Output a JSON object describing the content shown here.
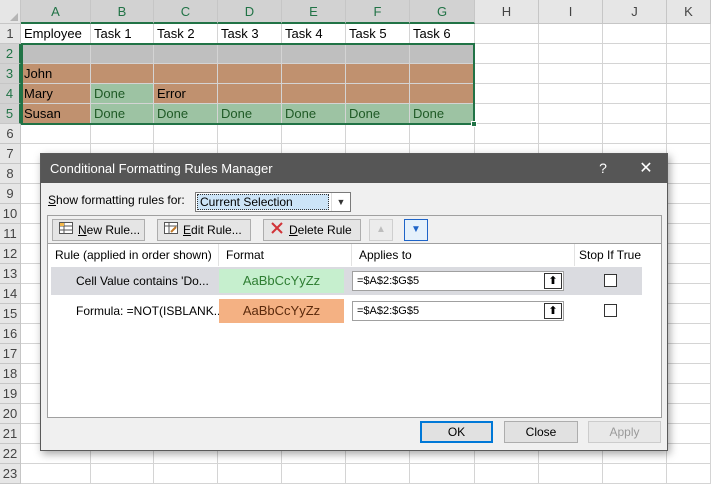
{
  "spreadsheet": {
    "columns": [
      "A",
      "B",
      "C",
      "D",
      "E",
      "F",
      "G",
      "H",
      "I",
      "J",
      "K"
    ],
    "rows": [
      "1",
      "2",
      "3",
      "4",
      "5",
      "6",
      "7",
      "8",
      "9",
      "10",
      "11",
      "12",
      "13",
      "14",
      "15",
      "16",
      "17",
      "18",
      "19",
      "20",
      "21",
      "22",
      "23"
    ],
    "header_row": [
      "Employee",
      "Task 1",
      "Task 2",
      "Task 3",
      "Task 4",
      "Task 5",
      "Task 6"
    ],
    "data_rows": [
      [
        "John",
        "",
        "",
        "",
        "",
        "",
        ""
      ],
      [
        "Mary",
        "Done",
        "Error",
        "",
        "",
        "",
        ""
      ],
      [
        "Susan",
        "Done",
        "Done",
        "Done",
        "Done",
        "Done",
        "Done"
      ]
    ],
    "colors": {
      "brown": "#c0916f",
      "green": "#9dc3a3",
      "gray": "#bfbfbf",
      "selection": "#217346"
    }
  },
  "dialog": {
    "title": "Conditional Formatting Rules Manager",
    "help": "?",
    "close": "✕",
    "show_label_pre": "",
    "show_label_key": "S",
    "show_label_post": "how formatting rules for:",
    "show_value": "Current Selection",
    "toolbar": {
      "new_rule_key": "N",
      "new_rule_rest": "ew Rule...",
      "edit_rule_key": "E",
      "edit_rule_rest": "dit Rule...",
      "delete_rule_key": "D",
      "delete_rule_rest": "elete Rule"
    },
    "columns": {
      "rule": "Rule (applied in order shown)",
      "format": "Format",
      "applies": "Applies to",
      "stop": "Stop If True"
    },
    "rules": [
      {
        "name": "Cell Value contains 'Do...",
        "preview": "AaBbCcYyZz",
        "applies": "=$A$2:$G$5",
        "stop": false
      },
      {
        "name": "Formula: =NOT(ISBLANK...",
        "preview": "AaBbCcYyZz",
        "applies": "=$A$2:$G$5",
        "stop": false
      }
    ],
    "buttons": {
      "ok": "OK",
      "close": "Close",
      "apply": "Apply"
    }
  }
}
